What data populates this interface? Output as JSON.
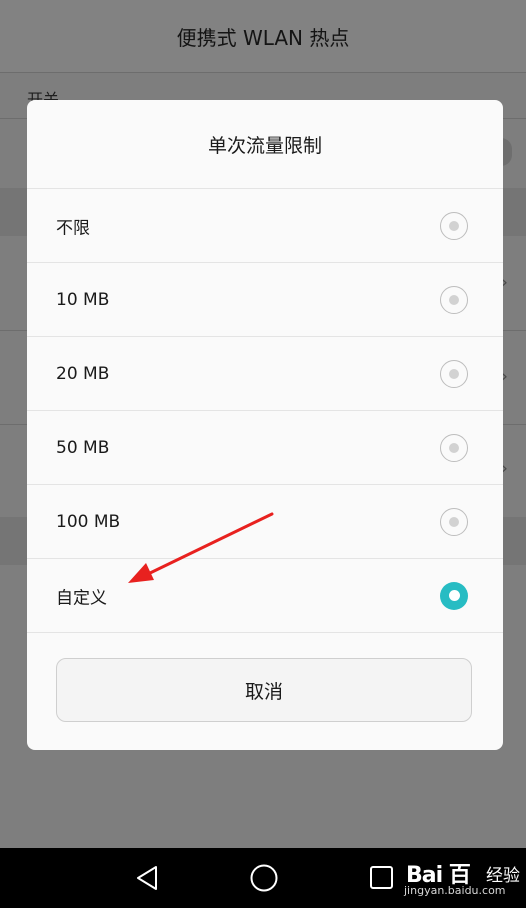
{
  "background": {
    "title": "便携式 WLAN 热点",
    "switch_label": "开关"
  },
  "dialog": {
    "title": "单次流量限制",
    "options": [
      {
        "label": "不限",
        "selected": false
      },
      {
        "label": "10 MB",
        "selected": false
      },
      {
        "label": "20 MB",
        "selected": false
      },
      {
        "label": "50 MB",
        "selected": false
      },
      {
        "label": "100 MB",
        "selected": false
      },
      {
        "label": "自定义",
        "selected": true
      }
    ],
    "cancel_label": "取消"
  },
  "navbar": {
    "icons": [
      "back-icon",
      "home-icon",
      "recents-icon"
    ]
  },
  "watermark": {
    "logo": "Bai 百",
    "text": "经验",
    "url": "jingyan.baidu.com"
  },
  "colors": {
    "accent": "#27bcc3",
    "annotation": "#e8211f"
  }
}
